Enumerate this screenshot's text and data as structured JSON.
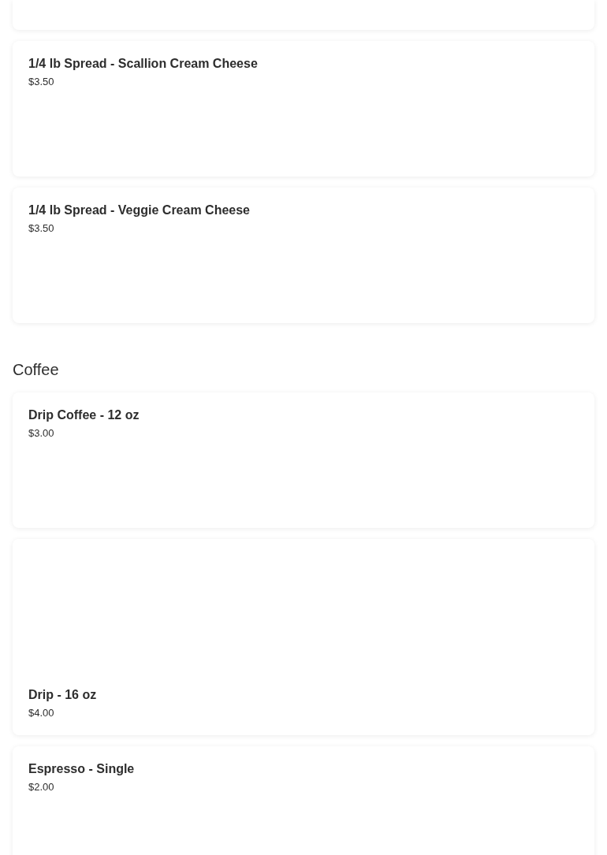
{
  "sections": [
    {
      "cut_off_card_above": true,
      "items": [
        {
          "name": "1/4 lb Spread - Scallion Cream Cheese",
          "price": "$3.50",
          "has_image": false
        },
        {
          "name": "1/4 lb Spread - Veggie Cream Cheese",
          "price": "$3.50",
          "has_image": false
        }
      ]
    },
    {
      "title": "Coffee",
      "cut_off_card_above": false,
      "items": [
        {
          "name": "Drip Coffee - 12 oz",
          "price": "$3.00",
          "has_image": false
        },
        {
          "name": "Drip - 16 oz",
          "price": "$4.00",
          "has_image": true
        },
        {
          "name": "Espresso - Single",
          "price": "$2.00",
          "has_image": false
        }
      ]
    }
  ]
}
